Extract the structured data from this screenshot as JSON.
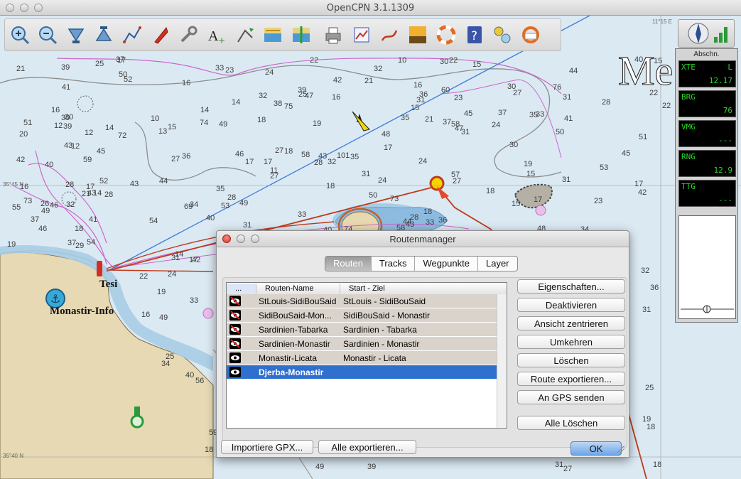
{
  "window": {
    "title": "OpenCPN 3.1.1309"
  },
  "chart": {
    "sea_label": "Me",
    "place_labels": [
      {
        "key": "tesi",
        "text": "Tesi"
      },
      {
        "key": "monastir",
        "text": "Monastir-Info"
      }
    ],
    "lat_labels": [
      "35°45 N",
      "35°40 N",
      "11°15 E"
    ],
    "depths": [
      "59",
      "58",
      "56",
      "60",
      "101",
      "58",
      "52",
      "54",
      "51",
      "57",
      "58",
      "50",
      "49",
      "43",
      "43",
      "45",
      "47",
      "46",
      "42",
      "36",
      "37",
      "40",
      "32",
      "53",
      "54",
      "55",
      "53",
      "51",
      "50",
      "39",
      "41",
      "42",
      "42",
      "46",
      "44",
      "35",
      "37",
      "36",
      "38",
      "40",
      "69",
      "41",
      "43",
      "33",
      "39",
      "39",
      "36",
      "36",
      "49",
      "49",
      "37",
      "47",
      "22",
      "33",
      "32",
      "37",
      "34",
      "59",
      "44",
      "50",
      "39",
      "32",
      "23",
      "28",
      "27",
      "24",
      "44",
      "31",
      "46",
      "49",
      "48",
      "43",
      "34",
      "49",
      "33",
      "31",
      "28",
      "41",
      "28",
      "30",
      "25",
      "23",
      "27",
      "26",
      "21",
      "19",
      "18",
      "24",
      "17",
      "16",
      "22",
      "31",
      "28",
      "19",
      "17",
      "27",
      "16",
      "16",
      "18",
      "18",
      "35",
      "42",
      "43",
      "40",
      "32",
      "30",
      "28",
      "21",
      "18",
      "28",
      "19",
      "18",
      "29",
      "30",
      "27",
      "19",
      "18",
      "27",
      "25",
      "45",
      "40",
      "34",
      "37",
      "32",
      "35",
      "24",
      "25",
      "33",
      "31",
      "25",
      "30",
      "20",
      "21",
      "19",
      "15",
      "14",
      "17",
      "15",
      "14",
      "18",
      "13",
      "27",
      "17",
      "17",
      "40",
      "35",
      "31",
      "30",
      "24",
      "22",
      "18",
      "17",
      "15",
      "14",
      "17",
      "14",
      "31",
      "12",
      "21",
      "31",
      "16",
      "15",
      "18",
      "16",
      "15",
      "12",
      "33",
      "23",
      "24",
      "22",
      "16",
      "17",
      "15",
      "14",
      "12",
      "11",
      "10",
      "31",
      "10",
      "22",
      "76",
      "75",
      "72",
      "74",
      "73",
      "73",
      "74",
      "52",
      "45",
      "48",
      "31"
    ]
  },
  "toolbar": {
    "buttons": [
      {
        "key": "zoom-in",
        "icon": "zoom-in-icon"
      },
      {
        "key": "zoom-out",
        "icon": "zoom-out-icon"
      },
      {
        "key": "scale-down",
        "icon": "scale-down-icon"
      },
      {
        "key": "scale-up",
        "icon": "scale-up-icon"
      },
      {
        "key": "route",
        "icon": "route-icon"
      },
      {
        "key": "follow",
        "icon": "follow-boat-icon"
      },
      {
        "key": "settings",
        "icon": "wrench-icon"
      },
      {
        "key": "text",
        "icon": "text-overlay-icon"
      },
      {
        "key": "current",
        "icon": "current-icon"
      },
      {
        "key": "tide",
        "icon": "tide-icon"
      },
      {
        "key": "quilt",
        "icon": "quilt-icon"
      },
      {
        "key": "print",
        "icon": "print-icon"
      },
      {
        "key": "route-manager",
        "icon": "route-manager-icon"
      },
      {
        "key": "track",
        "icon": "track-icon"
      },
      {
        "key": "color-scheme",
        "icon": "color-scheme-icon"
      },
      {
        "key": "mob",
        "icon": "lifebuoy-icon"
      },
      {
        "key": "help",
        "icon": "help-icon"
      },
      {
        "key": "ais",
        "icon": "ais-icon"
      },
      {
        "key": "about",
        "icon": "about-icon"
      }
    ]
  },
  "dashboard": {
    "header": "Abschn.",
    "instruments": [
      {
        "label": "XTE",
        "unit": "L",
        "value": "12.17"
      },
      {
        "label": "BRG",
        "unit": "",
        "value": "76"
      },
      {
        "label": "VMG",
        "unit": "",
        "value": "---"
      },
      {
        "label": "RNG",
        "unit": "",
        "value": "12.9"
      },
      {
        "label": "TTG",
        "unit": "",
        "value": "---"
      }
    ]
  },
  "dialog": {
    "title": "Routenmanager",
    "tabs": [
      "Routen",
      "Tracks",
      "Wegpunkte",
      "Layer"
    ],
    "active_tab": "Routen",
    "columns": [
      "...",
      "Routen-Name",
      "Start - Ziel"
    ],
    "routes": [
      {
        "name": "StLouis-SidiBouSaid",
        "from_to": "StLouis - SidiBouSaid",
        "active": false,
        "visible": false,
        "selected": false
      },
      {
        "name": "SidiBouSaid-Mon...",
        "from_to": "SidiBouSaid - Monastir",
        "active": false,
        "visible": false,
        "selected": false
      },
      {
        "name": "Sardinien-Tabarka",
        "from_to": "Sardinien - Tabarka",
        "active": false,
        "visible": false,
        "selected": false
      },
      {
        "name": "Sardinien-Monastir",
        "from_to": "Sardinien - Monastir",
        "active": false,
        "visible": false,
        "selected": false
      },
      {
        "name": "Monastir-Licata",
        "from_to": "Monastir - Licata",
        "active": false,
        "visible": true,
        "selected": false
      },
      {
        "name": "Djerba-Monastir",
        "from_to": "",
        "active": true,
        "visible": true,
        "selected": true
      }
    ],
    "buttons": {
      "properties": "Eigenschaften...",
      "deactivate": "Deaktivieren",
      "center_view": "Ansicht zentrieren",
      "reverse": "Umkehren",
      "delete": "Löschen",
      "export_route": "Route exportieren...",
      "send_gps": "An GPS senden",
      "delete_all": "Alle Löschen",
      "import_gpx": "Importiere GPX...",
      "export_all": "Alle exportieren...",
      "ok": "OK"
    }
  }
}
